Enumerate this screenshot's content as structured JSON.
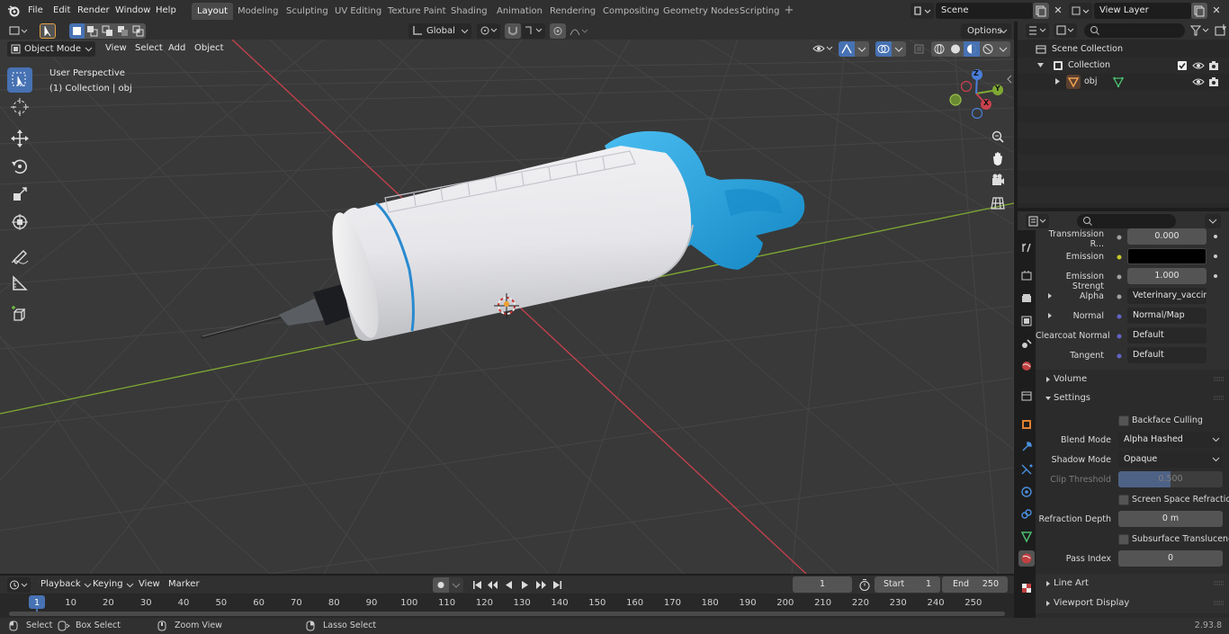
{
  "menu": {
    "file": "File",
    "edit": "Edit",
    "render": "Render",
    "window": "Window",
    "help": "Help"
  },
  "workspaces": [
    "Layout",
    "Modeling",
    "Sculpting",
    "UV Editing",
    "Texture Paint",
    "Shading",
    "Animation",
    "Rendering",
    "Compositing",
    "Geometry Nodes",
    "Scripting"
  ],
  "active_workspace": "Layout",
  "scene": {
    "name": "Scene",
    "view_layer": "View Layer"
  },
  "viewport_header": {
    "mode": "Object Mode",
    "view": "View",
    "select": "Select",
    "add": "Add",
    "object": "Object",
    "transform": "Global",
    "options": "Options"
  },
  "viewport_overlay": {
    "perspective": "User Perspective",
    "collection": "(1) Collection | obj"
  },
  "gizmo": {
    "x": "X",
    "y": "Y",
    "z": "Z"
  },
  "outliner": {
    "scene_collection": "Scene Collection",
    "collection": "Collection",
    "object": "obj"
  },
  "properties": {
    "rows": [
      {
        "label": "Transmission R...",
        "value": "0.000",
        "kind": "slider"
      },
      {
        "label": "Emission",
        "value": "",
        "kind": "color"
      },
      {
        "label": "Emission Strengt",
        "value": "1.000",
        "kind": "slider"
      },
      {
        "label": "Alpha",
        "value": "Veterinary_vaccine_...",
        "kind": "link"
      },
      {
        "label": "Normal",
        "value": "Normal/Map",
        "kind": "link"
      },
      {
        "label": "Clearcoat Normal",
        "value": "Default",
        "kind": "link"
      },
      {
        "label": "Tangent",
        "value": "Default",
        "kind": "link"
      }
    ],
    "volume": "Volume",
    "settings": "Settings",
    "backface_culling": "Backface Culling",
    "blend_mode_label": "Blend Mode",
    "blend_mode": "Alpha Hashed",
    "shadow_mode_label": "Shadow Mode",
    "shadow_mode": "Opaque",
    "clip_threshold_label": "Clip Threshold",
    "clip_threshold": "0.500",
    "ssr": "Screen Space Refraction",
    "refraction_depth_label": "Refraction Depth",
    "refraction_depth": "0 m",
    "subsurface": "Subsurface Translucency",
    "pass_index_label": "Pass Index",
    "pass_index": "0",
    "line_art": "Line Art",
    "viewport_display": "Viewport Display"
  },
  "timeline": {
    "playback": "Playback",
    "keying": "Keying",
    "view": "View",
    "marker": "Marker",
    "current_frame": "1",
    "start_label": "Start",
    "start": "1",
    "end_label": "End",
    "end": "250",
    "ticks": [
      "1",
      "10",
      "20",
      "30",
      "40",
      "50",
      "60",
      "70",
      "80",
      "90",
      "100",
      "110",
      "120",
      "130",
      "140",
      "150",
      "160",
      "170",
      "180",
      "190",
      "200",
      "210",
      "220",
      "230",
      "240",
      "250"
    ]
  },
  "status": {
    "select": "Select",
    "box_select": "Box Select",
    "zoom_view": "Zoom View",
    "lasso_select": "Lasso Select",
    "version": "2.93.8"
  },
  "colors": {
    "accent": "#4772b3",
    "syringe_blue": "#1fa3e0",
    "x_axis": "#c8414d",
    "y_axis": "#7fa932"
  }
}
